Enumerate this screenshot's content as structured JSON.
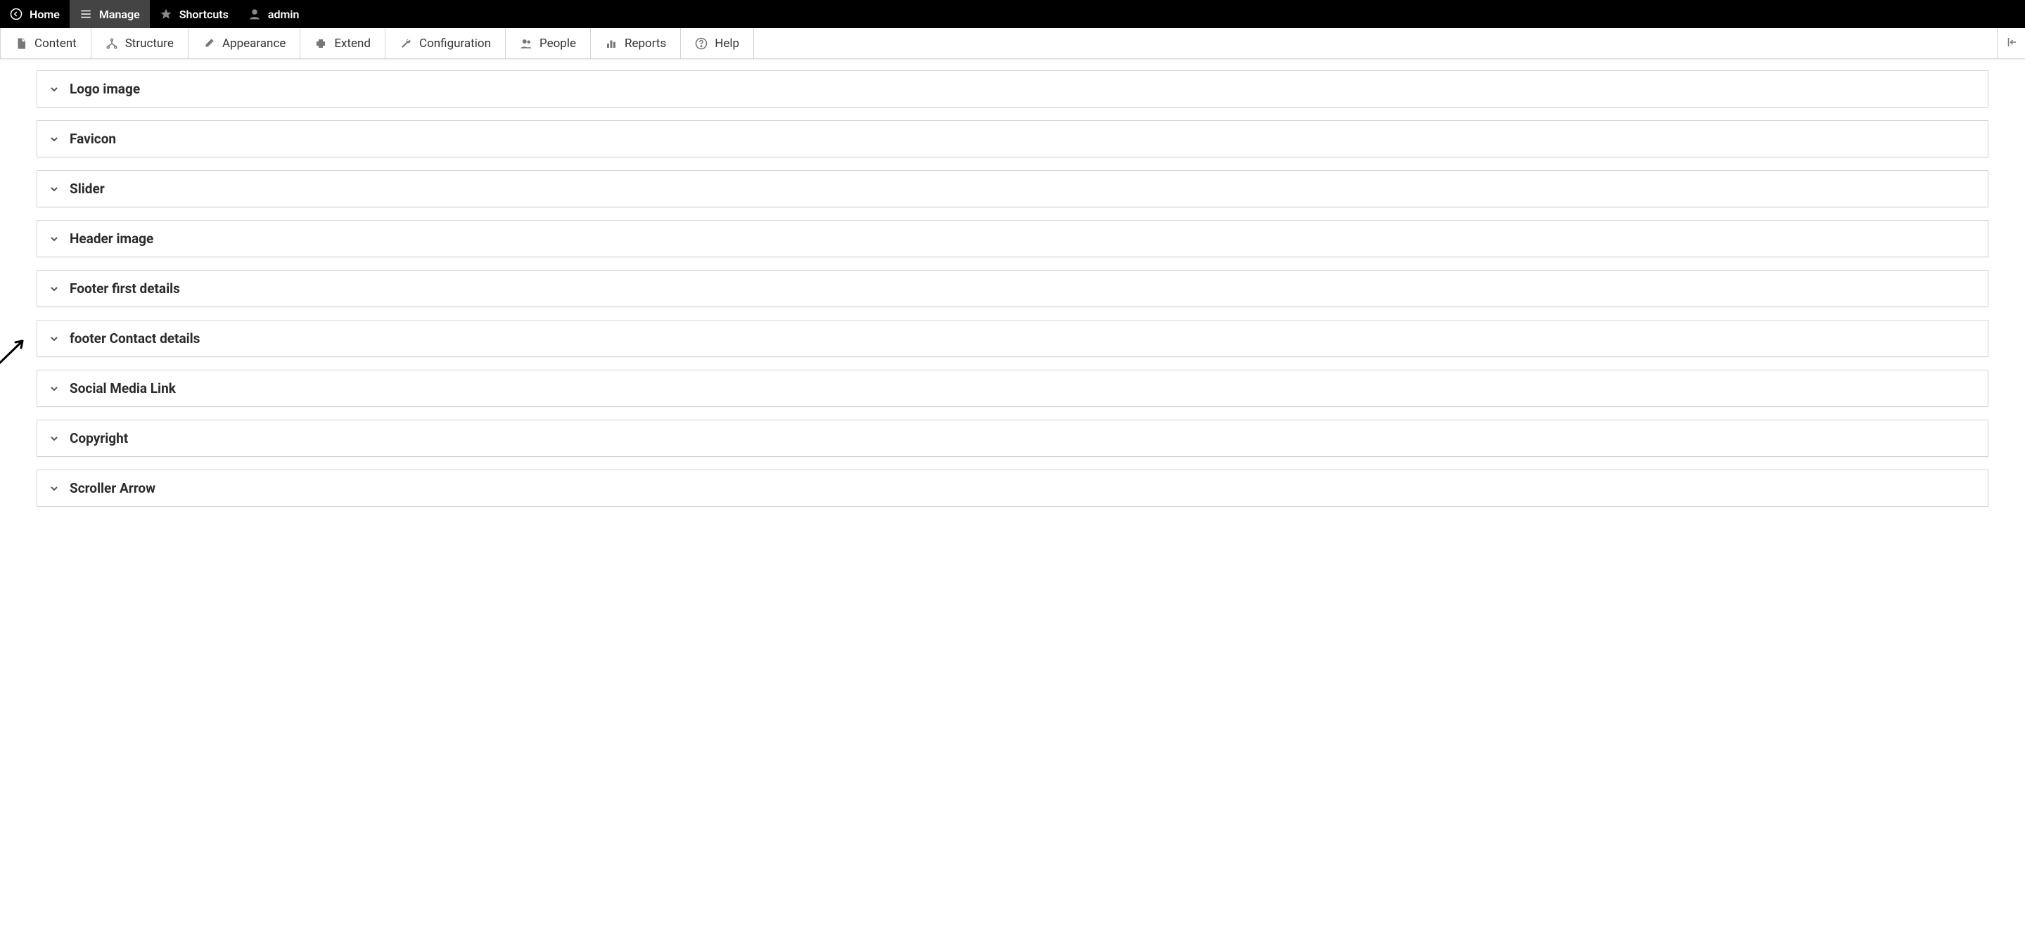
{
  "toolbar": {
    "home": "Home",
    "manage": "Manage",
    "shortcuts": "Shortcuts",
    "user": "admin"
  },
  "adminMenu": {
    "content": "Content",
    "structure": "Structure",
    "appearance": "Appearance",
    "extend": "Extend",
    "configuration": "Configuration",
    "people": "People",
    "reports": "Reports",
    "help": "Help"
  },
  "panels": {
    "logo": "Logo image",
    "favicon": "Favicon",
    "slider": "Slider",
    "headerImage": "Header image",
    "footerFirst": "Footer first details",
    "footerContact": "footer Contact details",
    "social": "Social Media Link",
    "copyright": "Copyright",
    "scroller": "Scroller Arrow"
  }
}
